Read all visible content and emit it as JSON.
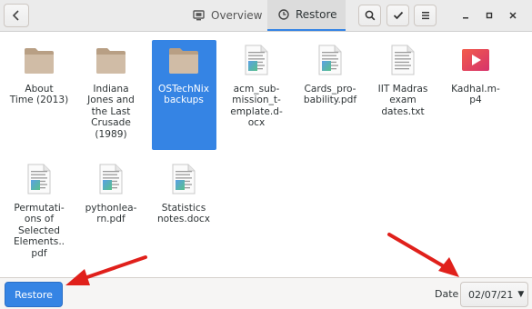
{
  "header": {
    "tabs": [
      {
        "label": "Overview",
        "icon": "screen-icon"
      },
      {
        "label": "Restore",
        "icon": "clock-icon"
      }
    ]
  },
  "files": [
    {
      "name": "About Time (2013)",
      "lines": [
        "About",
        "Time (2013)"
      ],
      "type": "folder"
    },
    {
      "name": "Indiana Jones and the Last Crusade (1989)",
      "lines": [
        "Indiana",
        "Jones and",
        "the Last",
        "Crusade",
        "(1989)"
      ],
      "type": "folder"
    },
    {
      "name": "OSTechNix backups",
      "lines": [
        "OSTechNix",
        "backups"
      ],
      "type": "folder",
      "selected": true
    },
    {
      "name": "acm_submission_template.docx",
      "lines": [
        "acm_sub-",
        "mission_t-",
        "emplate.d-",
        "ocx"
      ],
      "type": "document"
    },
    {
      "name": "Cards_probability.pdf",
      "lines": [
        "Cards_pro-",
        "bability.pdf"
      ],
      "type": "pdf"
    },
    {
      "name": "IIT Madras exam dates.txt",
      "lines": [
        "IIT Madras",
        "exam",
        "dates.txt"
      ],
      "type": "text"
    },
    {
      "name": "Kadhal.mp4",
      "lines": [
        "Kadhal.m-",
        "p4"
      ],
      "type": "video"
    },
    {
      "name": "Permutations of Selected Elements..pdf",
      "lines": [
        "Permutati-",
        "ons of",
        "Selected",
        "Elements..",
        "pdf"
      ],
      "type": "pdf"
    },
    {
      "name": "pythonlearn.pdf",
      "lines": [
        "pythonlea-",
        "rn.pdf"
      ],
      "type": "pdf"
    },
    {
      "name": "Statistics notes.docx",
      "lines": [
        "Statistics",
        "notes.docx"
      ],
      "type": "document"
    }
  ],
  "footer": {
    "restore_label": "Restore",
    "date_label": "Date",
    "date_value": "02/07/21"
  },
  "colors": {
    "accent": "#3584e4",
    "annotation_arrow": "#e0201b",
    "folder": "#c9b59e"
  }
}
